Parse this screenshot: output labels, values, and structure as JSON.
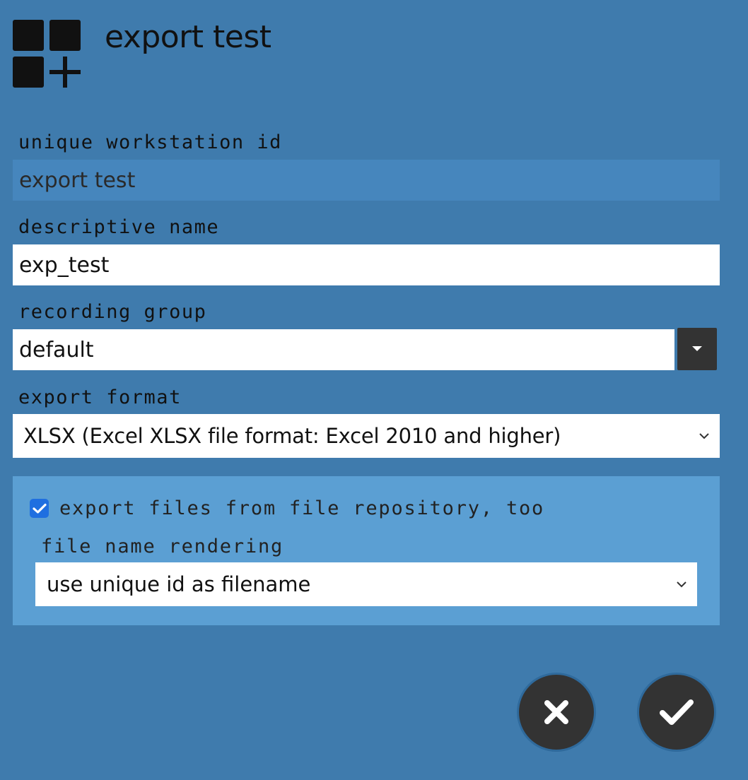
{
  "header": {
    "icon": "grid-add-icon",
    "title": "export test"
  },
  "form": {
    "workstation_id": {
      "label": "unique workstation id",
      "value": "export test"
    },
    "descriptive_name": {
      "label": "descriptive name",
      "value": "exp_test"
    },
    "recording_group": {
      "label": "recording group",
      "value": "default",
      "dropdown_icon": "caret-down-icon"
    },
    "export_format": {
      "label": "export format",
      "selected": "XLSX (Excel XLSX file format: Excel 2010 and higher)"
    },
    "file_repository": {
      "checkbox_label": "export files from file repository, too",
      "checked": true,
      "file_name_rendering_label": "file name rendering",
      "file_name_rendering_selected": "use unique id as filename"
    }
  },
  "actions": {
    "cancel_icon": "close-icon",
    "confirm_icon": "check-icon"
  },
  "colors": {
    "background": "#3f7bad",
    "panel": "#5b9fd3",
    "button_dark": "#333333",
    "checkbox": "#1f6fe0"
  }
}
